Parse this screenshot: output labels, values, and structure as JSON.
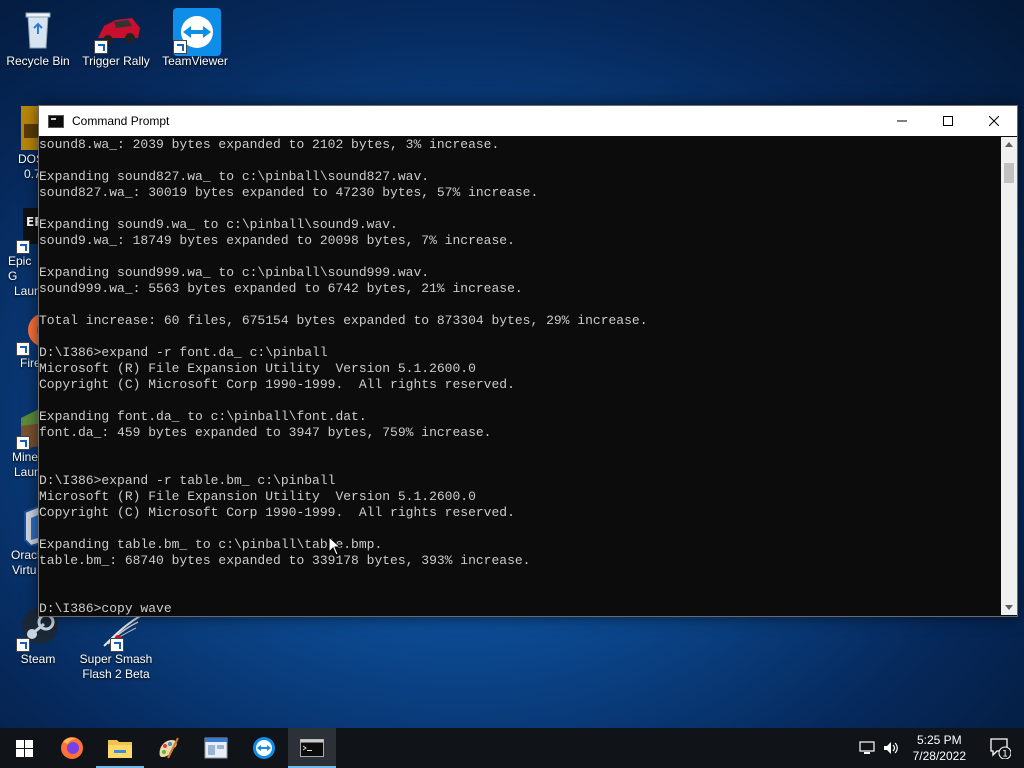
{
  "desktop": {
    "icons": {
      "recycle_bin": "Recycle Bin",
      "trigger_rally": "Trigger Rally",
      "teamviewer": "TeamViewer",
      "dosbox": "DOS",
      "dosbox_2": "0.7",
      "epic": "Epic G",
      "epic_2": "Laun",
      "firefox": "Fire",
      "minecraft": "Mine",
      "minecraft_2": "Laun",
      "oracle": "Oracl",
      "oracle_2": "Virtu",
      "steam": "Steam",
      "super_smash": "Super Smash Flash 2 Beta"
    }
  },
  "window": {
    "title": "Command Prompt",
    "console_text": "sound8.wa_: 2039 bytes expanded to 2102 bytes, 3% increase.\n\nExpanding sound827.wa_ to c:\\pinball\\sound827.wav.\nsound827.wa_: 30019 bytes expanded to 47230 bytes, 57% increase.\n\nExpanding sound9.wa_ to c:\\pinball\\sound9.wav.\nsound9.wa_: 18749 bytes expanded to 20098 bytes, 7% increase.\n\nExpanding sound999.wa_ to c:\\pinball\\sound999.wav.\nsound999.wa_: 5563 bytes expanded to 6742 bytes, 21% increase.\n\nTotal increase: 60 files, 675154 bytes expanded to 873304 bytes, 29% increase.\n\nD:\\I386>expand -r font.da_ c:\\pinball\nMicrosoft (R) File Expansion Utility  Version 5.1.2600.0\nCopyright (C) Microsoft Corp 1990-1999.  All rights reserved.\n\nExpanding font.da_ to c:\\pinball\\font.dat.\nfont.da_: 459 bytes expanded to 3947 bytes, 759% increase.\n\n\nD:\\I386>expand -r table.bm_ c:\\pinball\nMicrosoft (R) File Expansion Utility  Version 5.1.2600.0\nCopyright (C) Microsoft Corp 1990-1999.  All rights reserved.\n\nExpanding table.bm_ to c:\\pinball\\table.bmp.\ntable.bm_: 68740 bytes expanded to 339178 bytes, 393% increase.\n\n\nD:\\I386>copy wave"
  },
  "taskbar": {
    "time": "5:25 PM",
    "date": "7/28/2022",
    "notification_count": "1"
  },
  "colors": {
    "console_bg": "#0c0c0c",
    "console_fg": "#cccccc",
    "taskbar_bg": "#101419",
    "accent": "#76b9ed"
  }
}
